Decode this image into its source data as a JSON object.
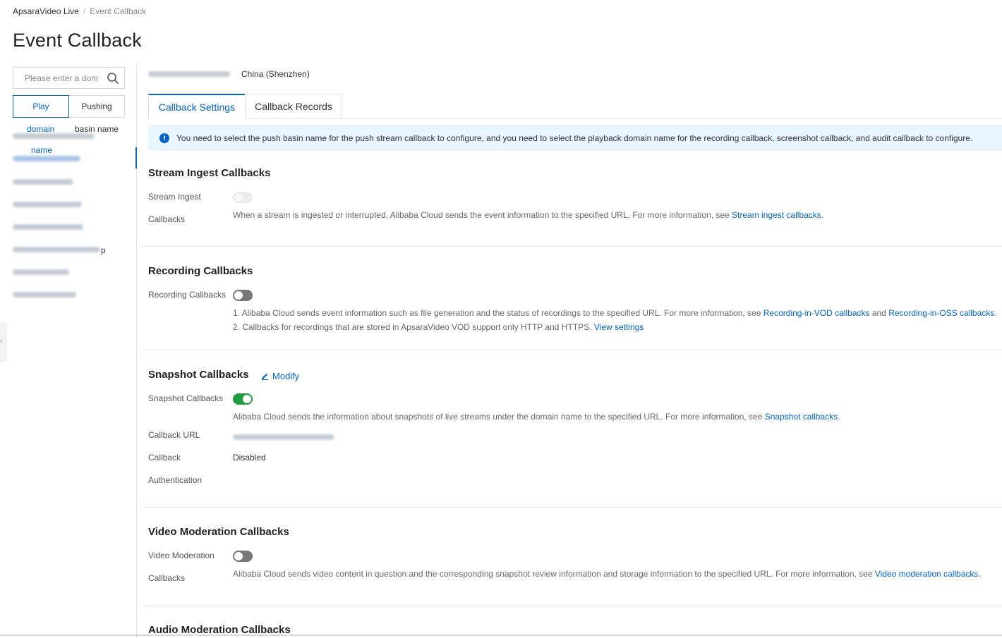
{
  "breadcrumb": {
    "root": "ApsaraVideo Live",
    "separator": "/",
    "current": "Event Callback"
  },
  "page_title": "Event Callback",
  "sidebar": {
    "search_placeholder": "Please enter a dom",
    "segments": [
      {
        "label": "Play",
        "active": true
      },
      {
        "label": "Pushing",
        "active": false
      }
    ],
    "columns": {
      "domain": "domain",
      "basin": "basin name",
      "name": "name"
    },
    "partial_text": {
      "item_6_suffix": "p"
    }
  },
  "main": {
    "region": "China (Shenzhen)",
    "tabs": [
      {
        "label": "Callback Settings",
        "active": true
      },
      {
        "label": "Callback Records",
        "active": false
      }
    ],
    "notice": "You need to select the push basin name for the push stream callback to configure, and you need to select the playback domain name for the recording callback, screenshot callback, and audit callback to configure.",
    "stream_ingest": {
      "title": "Stream Ingest Callbacks",
      "label_line1": "Stream Ingest",
      "label_line2": "Callbacks",
      "switch_state": "disabled",
      "desc": "When a stream is ingested or interrupted, Alibaba Cloud sends the event information to the specified URL. For more information, see ",
      "link": "Stream ingest callbacks",
      "desc_end": "."
    },
    "recording": {
      "title": "Recording Callbacks",
      "label": "Recording Callbacks",
      "switch_state": "off",
      "line1": "1. Alibaba Cloud sends event information such as file generation and the status of recordings to the specified URL. For more information, see ",
      "line1_link1": "Recording-in-VOD callbacks",
      "line1_and": " and ",
      "line1_link2": "Recording-in-OSS callbacks",
      "line1_end": ".",
      "line2": "2. Callbacks for recordings that are stored in ApsaraVideo VOD support only HTTP and HTTPS. ",
      "line2_link": "View settings"
    },
    "snapshot": {
      "title": "Snapshot Callbacks",
      "modify": "Modify",
      "label": "Snapshot Callbacks",
      "switch_state": "on",
      "desc": "Alibaba Cloud sends the information about snapshots of live streams under the domain name to the specified URL. For more information, see ",
      "link": "Snapshot callbacks",
      "desc_end": ".",
      "callback_url_label": "Callback URL",
      "callback_label_line1": "Callback",
      "callback_label_line2": "Authentication",
      "callback_auth_value": "Disabled"
    },
    "video_moderation": {
      "title": "Video Moderation Callbacks",
      "label_line1": "Video Moderation",
      "label_line2": "Callbacks",
      "switch_state": "off",
      "desc": "Alibaba Cloud sends video content in question and the corresponding snapshot review information and storage information to the specified URL. For more information, see ",
      "link": "Video moderation callbacks",
      "desc_end": "."
    },
    "audio_moderation": {
      "title": "Audio Moderation Callbacks"
    }
  },
  "colors": {
    "accent": "#0064c8",
    "switch_on": "#1f9a3e",
    "notice_bg": "#e8f4ff"
  }
}
